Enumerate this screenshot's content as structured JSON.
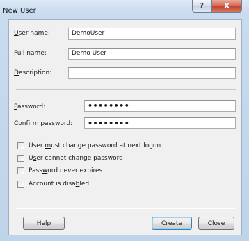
{
  "window": {
    "title": "New User",
    "help_glyph": "?",
    "close_glyph": "X"
  },
  "form": {
    "user_name": {
      "label_key": "U",
      "label_rest": "ser name:",
      "value": "DemoUser"
    },
    "full_name": {
      "label_key": "F",
      "label_rest": "ull name:",
      "value": "Demo User"
    },
    "description": {
      "label_key": "D",
      "label_rest": "escription:",
      "value": ""
    },
    "password": {
      "label_key": "P",
      "label_rest": "assword:",
      "value": "••••••••"
    },
    "confirm_password": {
      "label_key": "C",
      "label_rest": "onfirm password:",
      "value": "••••••••"
    }
  },
  "options": [
    {
      "pre": "User ",
      "key": "m",
      "post": "ust change password at next logon",
      "checked": false
    },
    {
      "pre": "U",
      "key": "s",
      "post": "er cannot change password",
      "checked": false
    },
    {
      "pre": "Pass",
      "key": "w",
      "post": "ord never expires",
      "checked": false
    },
    {
      "pre": "Account is disa",
      "key": "b",
      "post": "led",
      "checked": false
    }
  ],
  "buttons": {
    "help": {
      "key": "H",
      "rest": "elp"
    },
    "create": {
      "label": "Create"
    },
    "close": {
      "pre": "Cl",
      "key": "o",
      "post": "se"
    }
  },
  "icons": {
    "help": "help-icon",
    "close": "close-icon"
  }
}
